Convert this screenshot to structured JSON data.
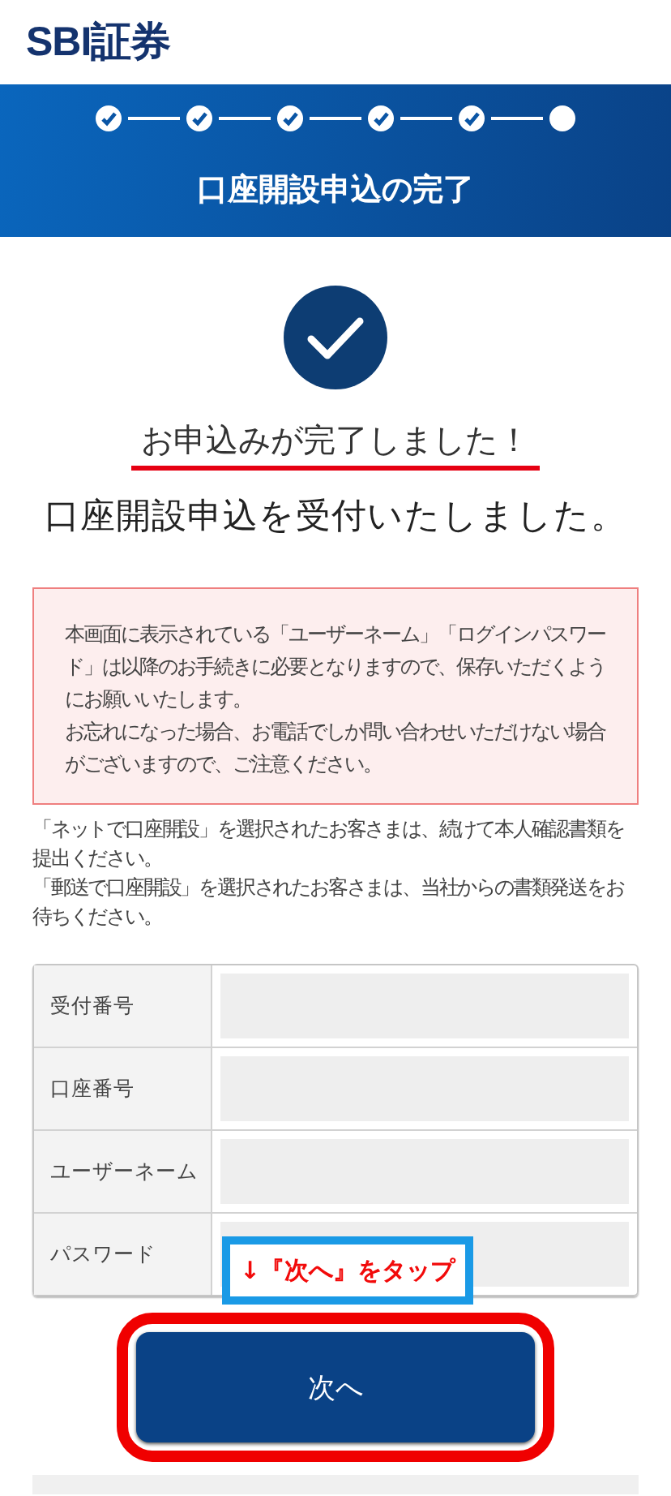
{
  "header": {
    "logo": "SBI証券"
  },
  "banner": {
    "steps": [
      {
        "done": true
      },
      {
        "done": true
      },
      {
        "done": true
      },
      {
        "done": true
      },
      {
        "done": true
      },
      {
        "done": false
      }
    ],
    "title": "口座開設申込の完了"
  },
  "completion": {
    "headline": "お申込みが完了しました！",
    "subtitle": "口座開設申込を受付いたしました。"
  },
  "notice": [
    "本画面に表示されている「ユーザーネーム」「ログインパスワード」は以降のお手続きに必要となりますので、保存いただくようにお願いいたします。",
    "お忘れになった場合、お電話でしか問い合わせいただけない場合がございますので、ご注意ください。"
  ],
  "instructions": [
    "「ネットで口座開設」を選択されたお客さまは、続けて本人確認書類を提出ください。",
    "「郵送で口座開設」を選択されたお客さまは、当社からの書類発送をお待ちください。"
  ],
  "table": {
    "rows": [
      {
        "label": "受付番号"
      },
      {
        "label": "口座番号"
      },
      {
        "label": "ユーザーネーム"
      },
      {
        "label": "パスワード"
      }
    ]
  },
  "callout": "↓『次へ』をタップ",
  "next_button": {
    "label": "次へ"
  }
}
